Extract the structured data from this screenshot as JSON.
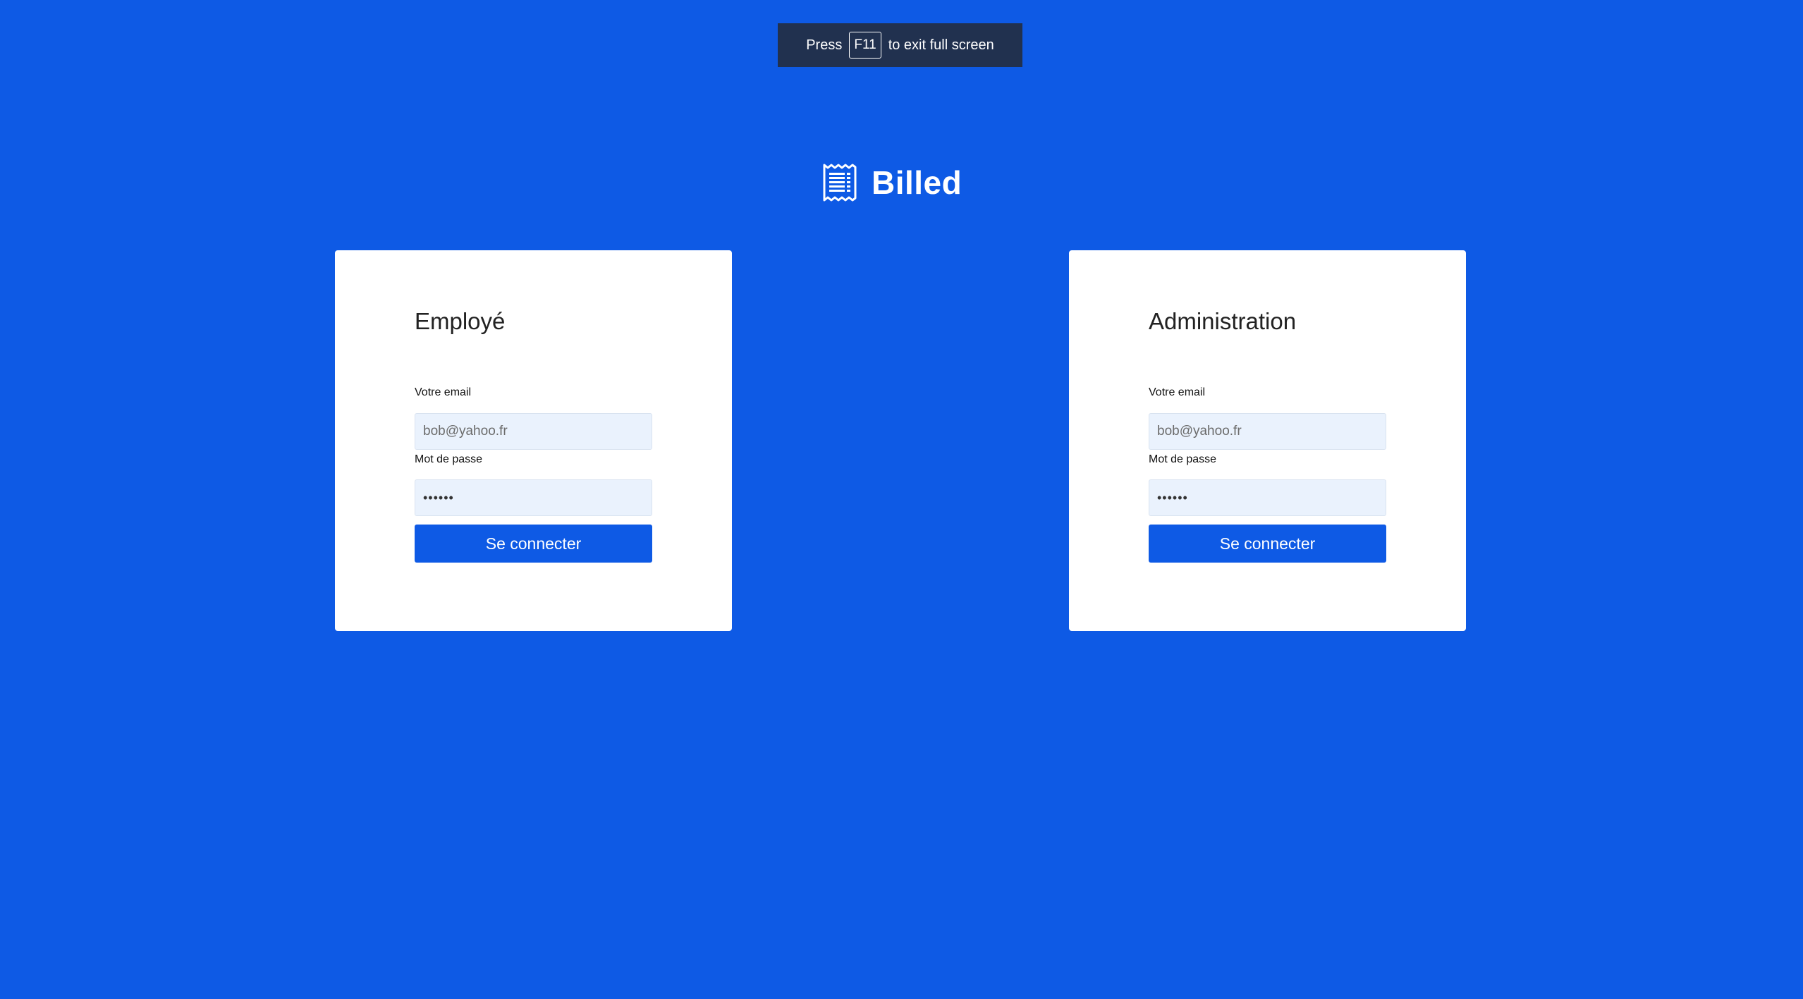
{
  "fullscreen_notice": {
    "prefix": "Press",
    "key": "F11",
    "suffix": "to exit full screen"
  },
  "brand": {
    "icon": "receipt-icon",
    "name": "Billed"
  },
  "employee_form": {
    "title": "Employé",
    "email_label": "Votre email",
    "email_placeholder": "bob@yahoo.fr",
    "password_label": "Mot de passe",
    "password_value": "••••••",
    "submit_label": "Se connecter"
  },
  "admin_form": {
    "title": "Administration",
    "email_label": "Votre email",
    "email_placeholder": "bob@yahoo.fr",
    "password_label": "Mot de passe",
    "password_value": "••••••",
    "submit_label": "Se connecter"
  },
  "colors": {
    "background": "#0e5ae5",
    "button": "#0e5ae5",
    "input_background": "#eaf2fd",
    "notice_background": "#21314f"
  }
}
